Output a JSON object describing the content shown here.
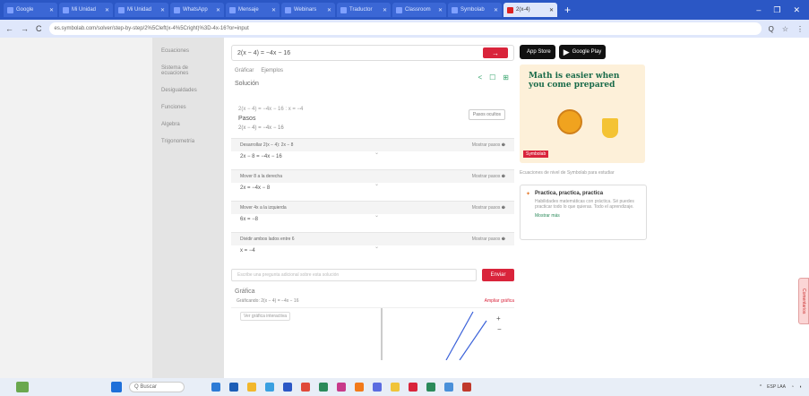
{
  "browser": {
    "tabs": [
      {
        "label": "Google",
        "active": false
      },
      {
        "label": "Mi Unidad",
        "active": false
      },
      {
        "label": "Mi Unidad",
        "active": false
      },
      {
        "label": "WhatsApp",
        "active": false
      },
      {
        "label": "Mensaje",
        "active": false
      },
      {
        "label": "Webinars",
        "active": false
      },
      {
        "label": "Traductor",
        "active": false
      },
      {
        "label": "Classroom",
        "active": false
      },
      {
        "label": "Symbolab",
        "active": false
      },
      {
        "label": "2(x-4)",
        "active": true
      }
    ],
    "new_tab": "+",
    "window_controls": [
      "–",
      "❐",
      "✕"
    ],
    "nav": [
      "←",
      "→",
      "C"
    ],
    "url": "es.symbolab.com/solver/step-by-step/2%5Cleft(x-4%5Cright)%3D-4x-16?or=input",
    "extensions": [
      "Q",
      "☆",
      "⋮"
    ]
  },
  "sidenav": [
    "Ecuaciones",
    "Sistema de ecuaciones",
    "Desigualdades",
    "Funciones",
    "Algebra",
    "Trigonometría"
  ],
  "main": {
    "equation": "2(x − 4) = −4x − 16",
    "go": "→",
    "subtabs": [
      "Gráficar",
      "Ejemplos"
    ],
    "share_icons": [
      "<",
      "☐",
      "⊞"
    ],
    "solution_title": "Solución",
    "step_mode": "Pasos ocultos",
    "given": "2(x − 4) = −4x − 16   :   x = −4",
    "pasos": "Pasos",
    "given2": "2(x − 4) = −4x − 16",
    "steps": [
      {
        "title": "Desarrollar 2(x − 4):   2x − 8",
        "result": "2x − 8 = −4x − 16"
      },
      {
        "title": "Mover 8 a la derecha",
        "result": "2x = −4x − 8"
      },
      {
        "title": "Mover 4x a la izquierda",
        "result": "6x = −8"
      },
      {
        "title": "Dividir ambos lados entre 6",
        "result": "x = −4"
      }
    ],
    "more_steps": "Mostrar pasos",
    "ask_placeholder": "Escribe una pregunta adicional sobre esta solución",
    "ask_button": "Enviar",
    "graph_title": "Gráfica",
    "graph_caption": "Gráficando: 2(x − 4) = −4x − 16",
    "graph_link": "Ampliar gráfica",
    "graph_chip": "Ver gráfica interactiva"
  },
  "ads": {
    "app_store": "App Store",
    "google_play": "Google Play",
    "headline": "Math is easier when you come prepared",
    "logo": "Symbolab",
    "caption": "Ecuaciones de nivel de Symbolab para estudiar",
    "card_title": "Practica, practica, practica",
    "card_desc": "Habilidades matemáticas con práctica. Sé puedes practicar todo lo que quieras. Todo el aprendizaje.",
    "card_link": "Mostrar más"
  },
  "feedback": "Comentarios",
  "taskbar": {
    "search": "Q Buscar",
    "app_colors": [
      "#2d7bd6",
      "#1c5db6",
      "#f2b72c",
      "#3aa0e0",
      "#2b57c5",
      "#e04a3a",
      "#2b8a5a",
      "#c83a8a",
      "#f27a1a",
      "#5b6ce0",
      "#f0c43a",
      "#d9243b",
      "#2b8a5a",
      "#4a90d9",
      "#c0392b"
    ],
    "tray_text": "ESP LAA"
  }
}
